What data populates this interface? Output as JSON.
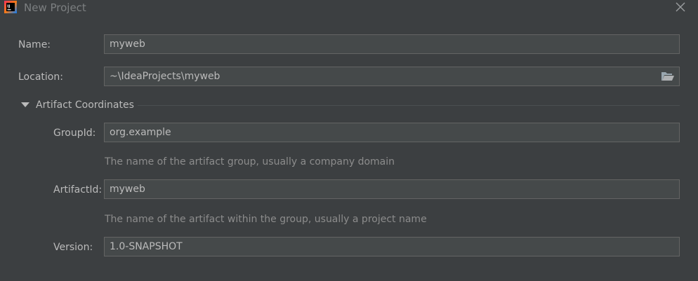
{
  "window": {
    "title": "New Project",
    "app_icon_text": "IJ"
  },
  "form": {
    "name_label": "Name:",
    "name_value": "myweb",
    "location_label": "Location:",
    "location_value": "~\\IdeaProjects\\myweb",
    "section_title": "Artifact Coordinates",
    "section_expanded": true,
    "groupid_label": "GroupId:",
    "groupid_value": "org.example",
    "groupid_hint": "The name of the artifact group, usually a company domain",
    "artifactid_label": "ArtifactId:",
    "artifactid_value": "myweb",
    "artifactid_hint": "The name of the artifact within the group, usually a project name",
    "version_label": "Version:",
    "version_value": "1.0-SNAPSHOT"
  },
  "icons": {
    "app": "intellij-idea-icon",
    "close": "close-icon",
    "folder": "folder-open-icon",
    "section_toggle": "triangle-down-icon"
  },
  "colors": {
    "background": "#3c3f41",
    "field_background": "#45494a",
    "field_border": "#646464",
    "text": "#bbbbbb",
    "hint_text": "#8c8c8c",
    "title_text": "#7c7f81"
  }
}
